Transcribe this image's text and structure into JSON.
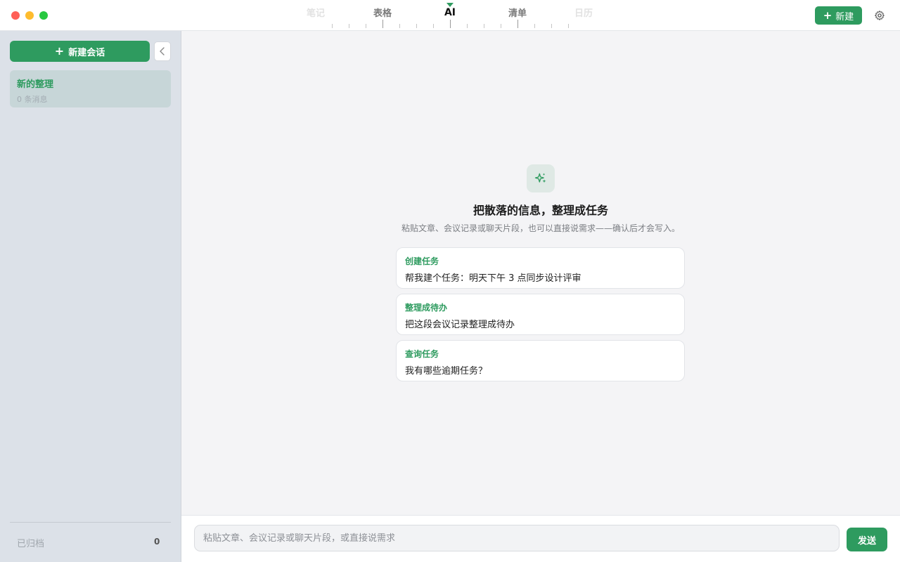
{
  "window": {
    "view_tabs": [
      {
        "label": "笔记",
        "state": "faded"
      },
      {
        "label": "表格",
        "state": "normal"
      },
      {
        "label": "AI",
        "state": "active"
      },
      {
        "label": "清单",
        "state": "normal"
      },
      {
        "label": "日历",
        "state": "faded"
      }
    ],
    "new_label": "新建",
    "settings_icon": "gear-icon"
  },
  "sidebar": {
    "new_chat_label": "新建会话",
    "sessions": [
      {
        "title": "新的整理",
        "meta": "0 条消息"
      }
    ],
    "archived_label": "已归档",
    "archived_count": "0"
  },
  "empty_state": {
    "icon": "sparkles-icon",
    "title": "把散落的信息，整理成任务",
    "subtitle": "粘贴文章、会议记录或聊天片段，也可以直接说需求——确认后才会写入。",
    "suggestions": [
      {
        "title": "创建任务",
        "text": "帮我建个任务：明天下午 3 点同步设计评审"
      },
      {
        "title": "整理成待办",
        "text": "把这段会议记录整理成待办"
      },
      {
        "title": "查询任务",
        "text": "我有哪些逾期任务？"
      }
    ]
  },
  "composer": {
    "placeholder": "粘贴文章、会议记录或聊天片段，或直接说需求",
    "value": "",
    "send_label": "发送"
  },
  "colors": {
    "accent": "#2e9b5f",
    "sidebar_bg": "#dce1e8",
    "selected_session_bg": "#c7d6d8",
    "close": "#ff5f57",
    "minimize": "#febc2e",
    "maximize": "#28c840"
  }
}
